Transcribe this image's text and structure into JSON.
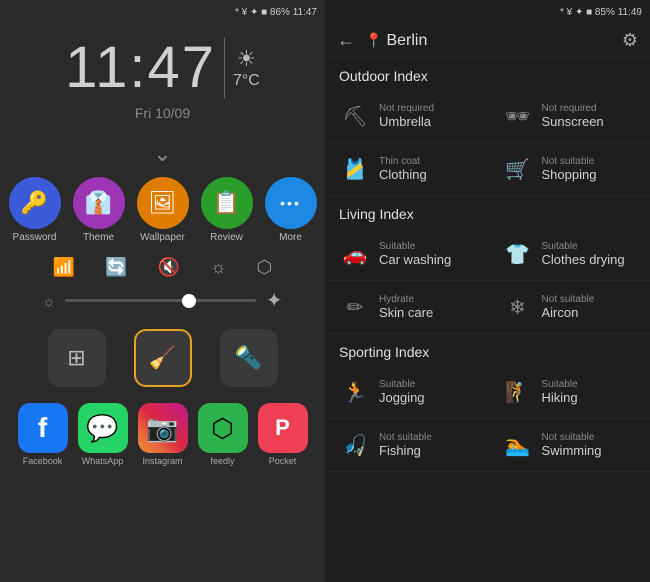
{
  "left": {
    "status_bar": "* ¥ ✦ ■ 86% 11:47",
    "time": "11:47",
    "date": "Fri 10/09",
    "temperature": "7°C",
    "apps": [
      {
        "label": "Password",
        "bg": "#3b5bdb",
        "icon": "🔑"
      },
      {
        "label": "Theme",
        "bg": "#9c36b5",
        "icon": "👔"
      },
      {
        "label": "Wallpaper",
        "bg": "#e07c00",
        "icon": "🖼"
      },
      {
        "label": "Review",
        "bg": "#2a9d2a",
        "icon": "📋"
      },
      {
        "label": "More",
        "bg": "#1e88e5",
        "icon": "···"
      }
    ],
    "bottom_shortcuts": [
      {
        "label": "calc",
        "icon": "⊞"
      },
      {
        "label": "clean",
        "icon": "🧹",
        "highlighted": true
      },
      {
        "label": "flashlight",
        "icon": "🔦"
      }
    ],
    "bottom_apps": [
      {
        "label": "Facebook",
        "icon": "f",
        "bg": "#1877f2"
      },
      {
        "label": "WhatsApp",
        "icon": "💬",
        "bg": "#25d366"
      },
      {
        "label": "Instagram",
        "icon": "📷",
        "bg": "#c13584"
      },
      {
        "label": "feedly",
        "icon": "⬡",
        "bg": "#2bb24c"
      },
      {
        "label": "Pocket",
        "icon": "P",
        "bg": "#ef4056"
      }
    ]
  },
  "right": {
    "status_bar": "* ¥ ✦ ■ 85% 11:49",
    "city": "Berlin",
    "sections": [
      {
        "title": "Outdoor Index",
        "items": [
          {
            "subtitle": "Not required",
            "label": "Umbrella",
            "icon": "⛏"
          },
          {
            "subtitle": "Not required",
            "label": "Sunscreen",
            "icon": "🕶"
          },
          {
            "subtitle": "Thin coat",
            "label": "Clothing",
            "icon": "🎽"
          },
          {
            "subtitle": "Not suitable",
            "label": "Shopping",
            "icon": "🛒"
          }
        ]
      },
      {
        "title": "Living Index",
        "items": [
          {
            "subtitle": "Suitable",
            "label": "Car washing",
            "icon": "🚗"
          },
          {
            "subtitle": "Suitable",
            "label": "Clothes drying",
            "icon": "👕"
          },
          {
            "subtitle": "Hydrate",
            "label": "Skin care",
            "icon": "✏"
          },
          {
            "subtitle": "Not suitable",
            "label": "Aircon",
            "icon": "❄"
          }
        ]
      },
      {
        "title": "Sporting Index",
        "items": [
          {
            "subtitle": "Suitable",
            "label": "Jogging",
            "icon": "🏃"
          },
          {
            "subtitle": "Suitable",
            "label": "Hiking",
            "icon": "🧗"
          },
          {
            "subtitle": "Not suitable",
            "label": "Fishing",
            "icon": "🎣"
          },
          {
            "subtitle": "Not suitable",
            "label": "Swimming",
            "icon": "🏊"
          }
        ]
      }
    ]
  }
}
